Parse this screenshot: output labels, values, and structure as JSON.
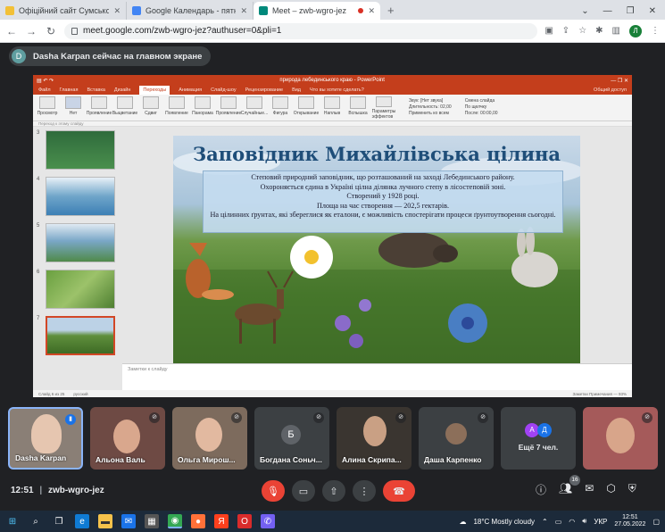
{
  "browser": {
    "tabs": [
      {
        "title": "Офіційний сайт Сумського дер...",
        "active": false,
        "color": "#f2c037"
      },
      {
        "title": "Google Календарь - пятница, 27...",
        "active": false,
        "color": "#4285f4"
      },
      {
        "title": "Meet – zwb-wgro-jez",
        "active": true,
        "color": "#00897b"
      }
    ],
    "new_tab": "+",
    "url": "meet.google.com/zwb-wgro-jez?authuser=0&pli=1",
    "profile_initial": "Л"
  },
  "meet": {
    "presenter_notice": "Dasha Karpan сейчас на главном экране",
    "presenter_initial": "D",
    "meeting_code": "zwb-wgro-jez",
    "time": "12:51",
    "participants_count": "16"
  },
  "powerpoint": {
    "window_title": "природа лебединського краю - PowerPoint",
    "user_label": "Общий доступ",
    "menu": [
      "Файл",
      "Главная",
      "Вставка",
      "Дизайн",
      "Переходы",
      "Анимация",
      "Слайд-шоу",
      "Рецензирование",
      "Вид",
      "Что вы хотите сделать?"
    ],
    "selected_menu": "Переходы",
    "ribbon_buttons": [
      "Просмотр",
      "Нет",
      "Проявление",
      "Выцветание",
      "Сдвиг",
      "Появление",
      "Панорама",
      "Проявление",
      "Случайные...",
      "Фигура",
      "Открывание",
      "Наплыв",
      "Вспышка",
      "Параметры эффектов"
    ],
    "ribbon_options": [
      "Звук: [Нет звука]",
      "Длительность: 02,00",
      "Применить ко всем"
    ],
    "ribbon_options_right": [
      "Смена слайда",
      "По щелчку",
      "После: 00:00,00"
    ],
    "section_label": "Переход к этому слайду",
    "notes_placeholder": "Заметки к слайду",
    "status_left": "Слайд 6 из 25",
    "status_lang": "русский",
    "status_right": "Заметки   Примечания   —   93%",
    "thumbnail_numbers": [
      "3",
      "4",
      "5",
      "6",
      "7"
    ]
  },
  "slide": {
    "title": "Заповідник Михайлівська цілина",
    "lines": [
      "Степовий природний заповідник, що розташований на заході Лебединського району.",
      "Охороняється єдина в Україні цілна ділянка лучного степу в лісостеповій зоні.",
      "Створений у 1928 році.",
      "Площа на час створення — 202,5 гектарів.",
      "На цілинних ґрунтах, які збереглися як еталони, є можливість спостерігати процеси ґрунтоутворення сьогодні."
    ]
  },
  "tiles": [
    {
      "name": "Dasha Karpan",
      "speaking": true,
      "kind": "video",
      "bg": "#8a7f76"
    },
    {
      "name": "Альона Валь",
      "speaking": false,
      "kind": "video",
      "bg": "#6e4a44"
    },
    {
      "name": "Ольга Мирош...",
      "speaking": false,
      "kind": "video",
      "bg": "#7d6b5d"
    },
    {
      "name": "Богдана Соньч...",
      "speaking": false,
      "kind": "avatar",
      "initial": "Б",
      "bg": "#5f6368"
    },
    {
      "name": "Алина Скрипа...",
      "speaking": false,
      "kind": "video",
      "bg": "#3a3530"
    },
    {
      "name": "Даша Карпенко",
      "speaking": false,
      "kind": "photo",
      "bg": "#8c6f5a"
    },
    {
      "name": "Ещё 7 чел.",
      "speaking": false,
      "kind": "more"
    },
    {
      "name": "",
      "speaking": false,
      "kind": "video",
      "bg": "#a55a5a"
    }
  ],
  "more_initials": [
    "А",
    "Д"
  ],
  "taskbar": {
    "weather": "18°C  Mostly cloudy",
    "lang": "УКР",
    "time": "12:51",
    "date": "27.05.2022"
  },
  "colors": {
    "meet_bg": "#202124",
    "ppt_accent": "#c43e1c",
    "slide_title": "#1f4e79",
    "hangup": "#ea4335"
  }
}
